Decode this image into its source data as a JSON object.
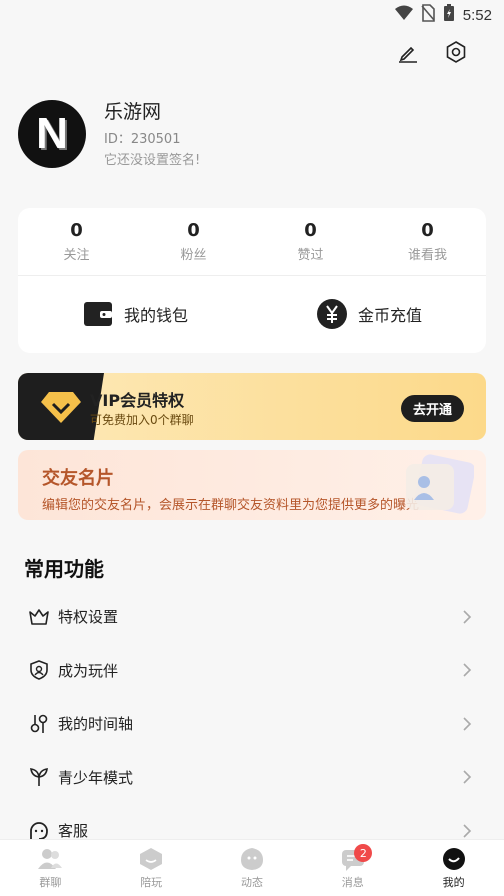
{
  "status_bar": {
    "time": "5:52"
  },
  "profile": {
    "avatar_letter": "N",
    "name": "乐游网",
    "id": "ID：230501",
    "signature": "它还没设置签名!"
  },
  "stats": [
    {
      "value": "0",
      "label": "关注"
    },
    {
      "value": "0",
      "label": "粉丝"
    },
    {
      "value": "0",
      "label": "赞过"
    },
    {
      "value": "0",
      "label": "谁看我"
    }
  ],
  "wallet": {
    "wallet_label": "我的钱包",
    "coin_label": "金币充值"
  },
  "vip": {
    "title": "VIP会员特权",
    "subtitle": "可免费加入0个群聊",
    "button": "去开通"
  },
  "friend_card": {
    "title": "交友名片",
    "desc": "编辑您的交友名片，会展示在群聊交友资料里为您提供更多的曝光"
  },
  "section_title": "常用功能",
  "menu": [
    {
      "label": "特权设置"
    },
    {
      "label": "成为玩伴"
    },
    {
      "label": "我的时间轴"
    },
    {
      "label": "青少年模式"
    },
    {
      "label": "客服"
    }
  ],
  "tabs": [
    {
      "label": "群聊"
    },
    {
      "label": "陪玩"
    },
    {
      "label": "动态"
    },
    {
      "label": "消息",
      "badge": "2"
    },
    {
      "label": "我的"
    }
  ]
}
